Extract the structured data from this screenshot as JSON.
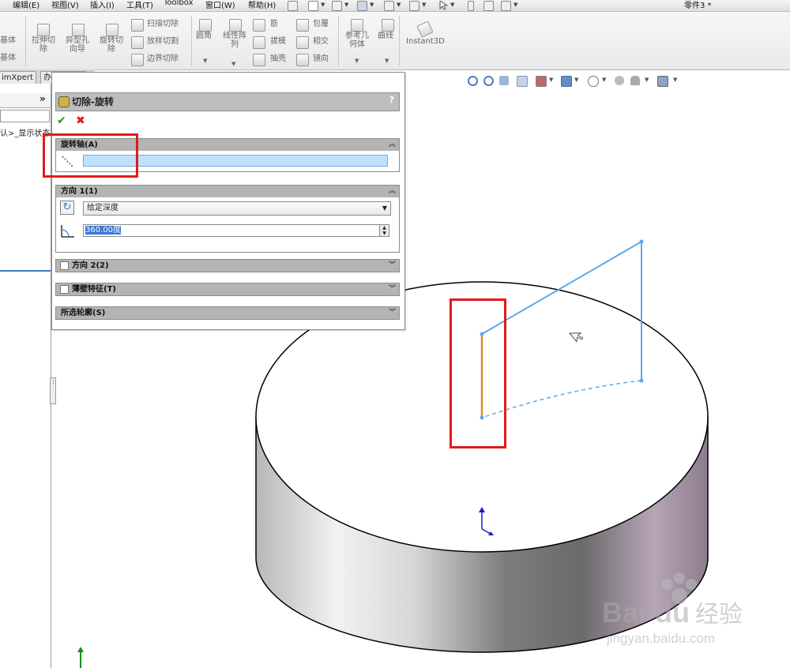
{
  "menu": {
    "items": [
      "编辑(E)",
      "视图(V)",
      "插入(I)",
      "工具(T)",
      "Toolbox",
      "窗口(W)",
      "帮助(H)"
    ],
    "document_title": "零件3 *"
  },
  "ribbon": {
    "left_labels": [
      "基体",
      "基体"
    ],
    "extrude_cut": "拉伸切\n除",
    "hole_wizard": "异型孔\n向导",
    "revolve_cut": "旋转切\n除",
    "swept_cut": "扫描切除",
    "loft_cut": "放样切割",
    "boundary_cut": "边界切除",
    "fillet": "圆角",
    "linear_pattern": "线性阵\n列",
    "rib": "筋",
    "wrap": "包覆",
    "draft": "拔模",
    "intersect": "相交",
    "shell": "抽壳",
    "mirror": "镜向",
    "reference_geometry": "参考几\n何体",
    "curves": "曲线",
    "instant3d": "Instant3D"
  },
  "manager_tabs": [
    "imXpert",
    "办公室产品"
  ],
  "left_panel": {
    "expand_glyph": "»",
    "display_state": "认>_显示状态"
  },
  "property_manager": {
    "title": "切除-旋转",
    "help": "?",
    "ok": "✔",
    "cancel": "✖",
    "axis_section": {
      "label": "旋转轴(A)",
      "axis_value": ""
    },
    "direction1": {
      "label": "方向 1(1)",
      "end_condition": "给定深度",
      "angle": "360.00度"
    },
    "direction2": {
      "label": "方向 2(2)"
    },
    "thin_feature": {
      "label": "薄壁特征(T)"
    },
    "selected_contours": {
      "label": "所选轮廓(S)"
    }
  },
  "watermark": {
    "brand": "Bai",
    "brand_suffix": "du",
    "cn": "经验",
    "url": "jingyan.baidu.com"
  },
  "colors": {
    "sketch_blue": "#5aa9ee",
    "axis_orange": "#e08a2a",
    "highlight_red": "#e01b1b",
    "input_blue": "#bfe2fc",
    "ok_green": "#1e9a1e",
    "cancel_red": "#d42020"
  }
}
